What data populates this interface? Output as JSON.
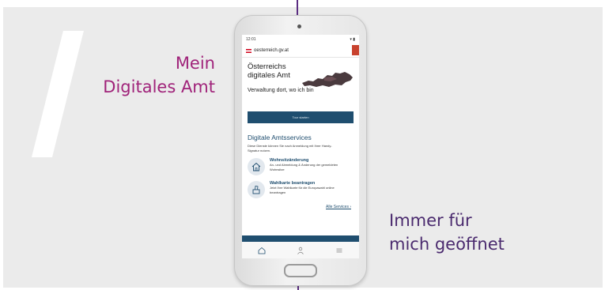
{
  "taglines": {
    "left_line1": "Mein",
    "left_line2": "Digitales Amt",
    "right_line1": "Immer für",
    "right_line2": "mich geöffnet"
  },
  "phone": {
    "status_time": "12:01",
    "status_icons": "▾ ▮",
    "url": "oesterreich.gv.at",
    "hero_title": "Österreichs digitales Amt",
    "hero_subtitle": "Verwaltung dort, wo ich bin",
    "cta_label": "Tour starten",
    "section_title": "Digitale Amtsservices",
    "section_description": "Diese Dienste können Sie nach Anmeldung mit Ihrer Handy-Signatur nutzen.",
    "services": [
      {
        "title": "Wohnsitzänderung",
        "description": "An- und Abmeldung & Änderung der gemeldeten Wohnsitze",
        "icon": "house-icon"
      },
      {
        "title": "Wahlkarte beantragen",
        "description": "Jetzt Ihre Wahlkarte für die Europawahl online beantragen",
        "icon": "ballot-box-icon"
      }
    ],
    "all_services_link": "Alle Services ›",
    "nav_icons": [
      "home-icon",
      "person-icon",
      "menu-icon"
    ]
  },
  "colors": {
    "accent_magenta": "#a0237a",
    "accent_purple": "#4a2a6e",
    "brand_blue": "#1f4e6f"
  }
}
